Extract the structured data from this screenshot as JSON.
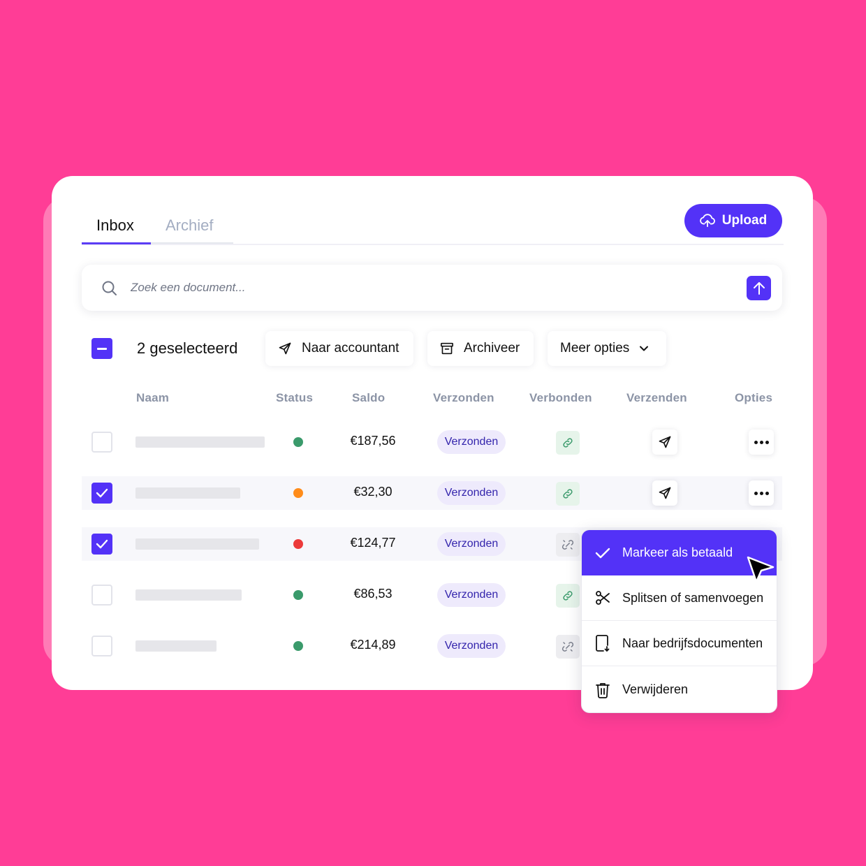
{
  "tabs": [
    {
      "label": "Inbox",
      "active": true
    },
    {
      "label": "Archief",
      "active": false
    }
  ],
  "upload": {
    "label": "Upload",
    "icon": "cloud-upload-icon"
  },
  "search": {
    "placeholder": "Zoek een document..."
  },
  "toolbar": {
    "selected_label": "2 geselecteerd",
    "naar_accountant": "Naar accountant",
    "archiveer": "Archiveer",
    "meer_opties": "Meer opties"
  },
  "columns": [
    "Naam",
    "Status",
    "Saldo",
    "Verzonden",
    "Verbonden",
    "Verzenden",
    "Opties"
  ],
  "rows": [
    {
      "checked": false,
      "status": "green",
      "saldo": "€187,56",
      "verzonden": "Verzonden",
      "verbonden": true,
      "has_actions": true
    },
    {
      "checked": true,
      "status": "orange",
      "saldo": "€32,30",
      "verzonden": "Verzonden",
      "verbonden": true,
      "has_actions": true
    },
    {
      "checked": true,
      "status": "red",
      "saldo": "€124,77",
      "verzonden": "Verzonden",
      "verbonden": false,
      "has_actions": false
    },
    {
      "checked": false,
      "status": "green",
      "saldo": "€86,53",
      "verzonden": "Verzonden",
      "verbonden": true,
      "has_actions": false
    },
    {
      "checked": false,
      "status": "green",
      "saldo": "€214,89",
      "verzonden": "Verzonden",
      "verbonden": false,
      "has_actions": false
    }
  ],
  "context_menu": [
    {
      "label": "Markeer als betaald",
      "icon": "check-icon",
      "active": true
    },
    {
      "label": "Splitsen of samenvoegen",
      "icon": "scissors-icon",
      "active": false
    },
    {
      "label": "Naar bedrijfsdocumenten",
      "icon": "document-download-icon",
      "active": false
    },
    {
      "label": "Verwijderen",
      "icon": "trash-icon",
      "active": false
    }
  ],
  "colors": {
    "background": "#FF3D96",
    "accent": "#5332F7",
    "status_green": "#3A9A6B",
    "status_orange": "#FF8C1A",
    "status_red": "#EC3A3A"
  }
}
